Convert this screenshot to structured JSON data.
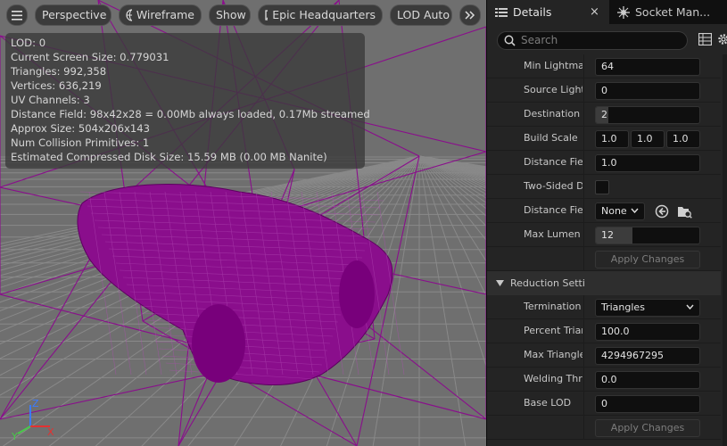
{
  "toolbar": {
    "perspective_label": "Perspective",
    "wireframe_label": "Wireframe",
    "show_label": "Show",
    "location_label": "Epic Headquarters",
    "lod_label": "LOD Auto"
  },
  "stats": {
    "lines": [
      "LOD:  0",
      "Current Screen Size:  0.779031",
      "Triangles:  992,358",
      "Vertices:  636,219",
      "UV Channels:  3",
      "Distance Field:  98x42x28 = 0.00Mb always loaded, 0.17Mb streamed",
      "Approx Size: 504x206x143",
      "Num Collision Primitives:  1",
      "Estimated Compressed Disk Size: 15.59 MB (0.00 MB Nanite)"
    ]
  },
  "gizmo": {
    "x_label": "X",
    "y_label": "Y",
    "z_label": "Z"
  },
  "tabs": {
    "details_label": "Details",
    "close_symbol": "×",
    "socket_label": "Socket Man..."
  },
  "search": {
    "placeholder": "Search"
  },
  "props": {
    "min_lightmap": {
      "label": "Min Lightmap Resolution",
      "value": "64"
    },
    "source_lightmap": {
      "label": "Source Lightmap Index",
      "value": "0"
    },
    "dest_lightmap": {
      "label": "Destination Lightmap Index",
      "value": "2",
      "level": 0.12
    },
    "build_scale": {
      "label": "Build Scale",
      "x": "1.0",
      "y": "1.0",
      "z": "1.0"
    },
    "df_resolution": {
      "label": "Distance Field Resolution Scale",
      "value": "1.0"
    },
    "two_sided": {
      "label": "Two-Sided Distance Field Generation"
    },
    "df_replacement": {
      "label": "Distance Field Replacement Mesh",
      "value": "None"
    },
    "max_lumen": {
      "label": "Max Lumen Mesh Cards",
      "value": "12",
      "level": 0.35
    },
    "apply1_label": "Apply Changes",
    "reduction_title": "Reduction Settings",
    "termination": {
      "label": "Termination",
      "value": "Triangles"
    },
    "percent_tri": {
      "label": "Percent Triangles",
      "value": "100.0"
    },
    "max_tri": {
      "label": "Max Triangle Count",
      "value": "4294967295"
    },
    "welding": {
      "label": "Welding Threshold",
      "value": "0.0"
    },
    "base_lod": {
      "label": "Base LOD",
      "value": "0"
    },
    "apply2_label": "Apply Changes"
  },
  "colors": {
    "wireframe": "#8a0e8c",
    "grid": "#8c8c8c",
    "viewport_bg": "#6f6f6f"
  }
}
